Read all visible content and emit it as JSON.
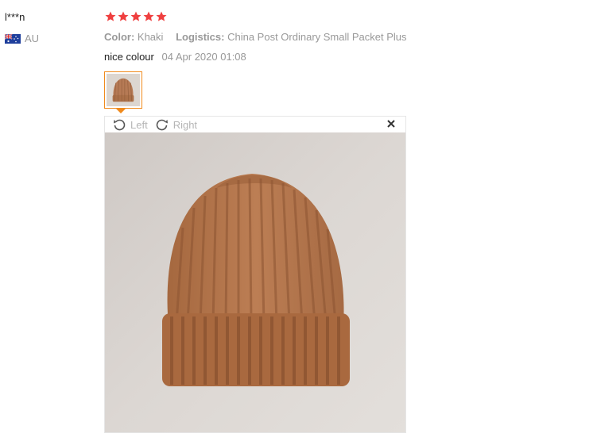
{
  "reviewer": {
    "name": "l***n",
    "country": "AU",
    "flag_icon": "australia-flag-icon"
  },
  "rating": {
    "stars": 5,
    "max": 5,
    "color": "#ef3f3f"
  },
  "attributes": {
    "color_label": "Color:",
    "color_value": "Khaki",
    "logistics_label": "Logistics:",
    "logistics_value": "China Post Ordinary Small Packet Plus"
  },
  "review": {
    "text": "nice colour",
    "date": "04 Apr 2020 01:08"
  },
  "viewer": {
    "rotate_left_label": "Left",
    "rotate_right_label": "Right",
    "rotate_left_icon": "rotate-left-icon",
    "rotate_right_icon": "rotate-right-icon",
    "close_icon": "close-icon",
    "accent_color": "#f08a1c"
  }
}
